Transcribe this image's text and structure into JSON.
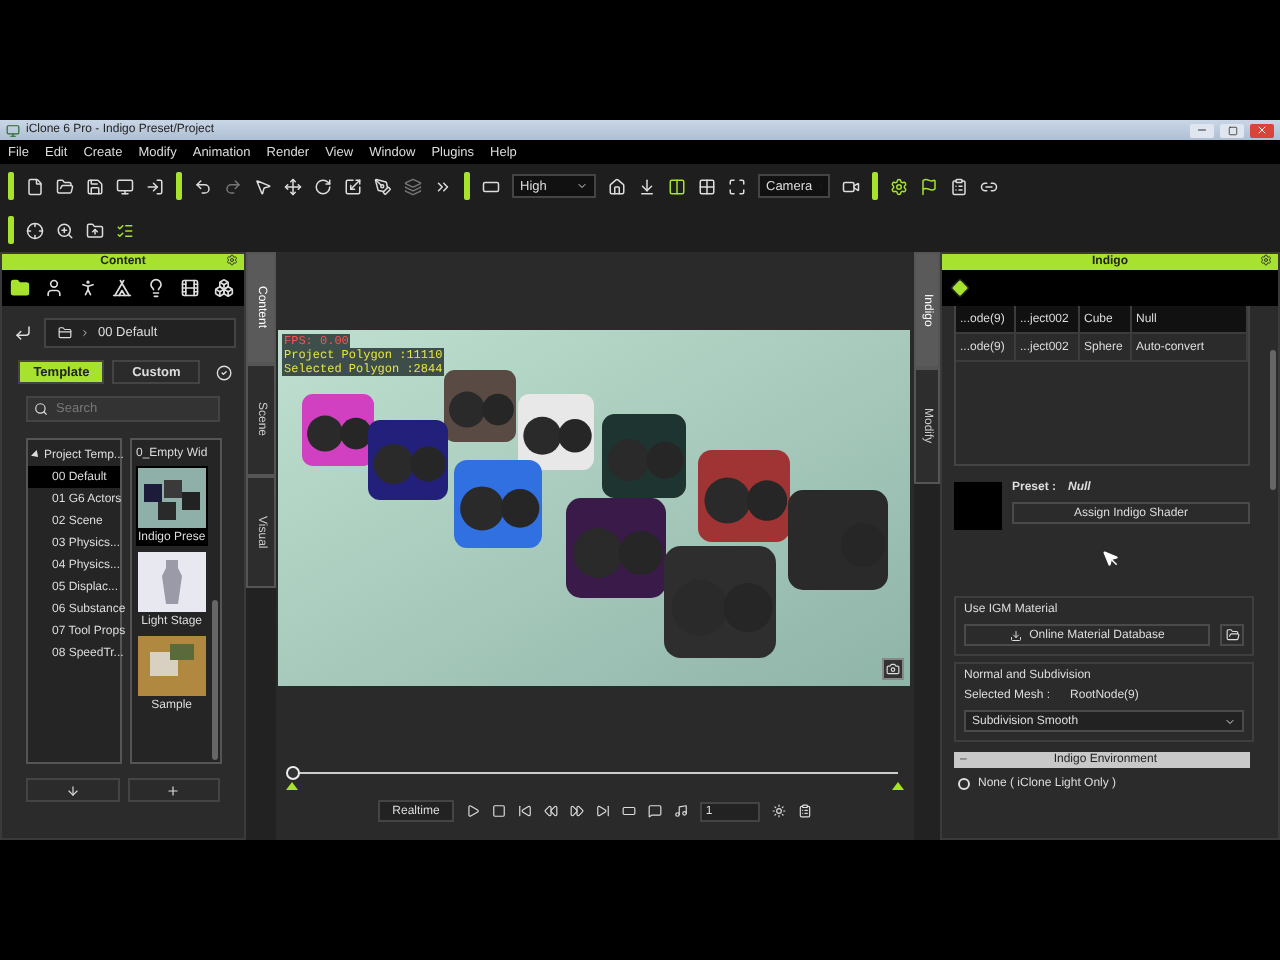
{
  "window": {
    "title": "iClone 6 Pro - Indigo Preset/Project"
  },
  "menu": [
    "File",
    "Edit",
    "Create",
    "Modify",
    "Animation",
    "Render",
    "View",
    "Window",
    "Plugins",
    "Help"
  ],
  "toolbar": {
    "quality": "High",
    "camera": "Camera"
  },
  "left_tabs": [
    {
      "label": "Content",
      "selected": true
    },
    {
      "label": "Scene",
      "selected": false
    },
    {
      "label": "Visual",
      "selected": false
    }
  ],
  "content_panel": {
    "title": "Content",
    "path": "00 Default",
    "tabs": [
      {
        "label": "Template",
        "selected": true
      },
      {
        "label": "Custom",
        "selected": false
      }
    ],
    "search": {
      "placeholder": "Search"
    },
    "tree": [
      {
        "label": "Project Temp...",
        "expanded": true,
        "selected": false,
        "children": [
          {
            "label": "00 Default",
            "selected": true
          },
          {
            "label": "01 G6 Actors",
            "selected": false
          },
          {
            "label": "02 Scene",
            "selected": false
          },
          {
            "label": "03 Physics...",
            "selected": false
          },
          {
            "label": "04 Physics...",
            "selected": false
          },
          {
            "label": "05 Displac...",
            "selected": false
          },
          {
            "label": "06 Substance",
            "selected": false
          },
          {
            "label": "07 Tool Props",
            "selected": false
          },
          {
            "label": "08 SpeedTr...",
            "selected": false
          }
        ]
      }
    ],
    "thumbnails": [
      {
        "label": "0_Empty Wid",
        "kind": "none",
        "selected": false
      },
      {
        "label": "Indigo Prese",
        "kind": "cubes",
        "selected": true
      },
      {
        "label": "Light Stage",
        "kind": "statue",
        "selected": false
      },
      {
        "label": "Sample",
        "kind": "room",
        "selected": false
      }
    ]
  },
  "viewport": {
    "overlay": [
      {
        "text": "FPS: 0.00",
        "kind": "fps"
      },
      {
        "text": "Project Polygon :11110",
        "kind": "stat"
      },
      {
        "text": "Selected Polygon :2844",
        "kind": "stat"
      }
    ]
  },
  "timeline": {
    "level": 0
  },
  "playback": {
    "mode": "Realtime",
    "frame": "1"
  },
  "right_tabs": [
    {
      "label": "Indigo",
      "selected": true
    },
    {
      "label": "Modify",
      "selected": false
    }
  ],
  "indigo_panel": {
    "title": "Indigo",
    "mesh_rows": [
      [
        "...ode(9)",
        "...ject002",
        "Cube",
        "Null"
      ],
      [
        "...ode(9)",
        "...ject002",
        "Sphere",
        "Auto-convert"
      ]
    ],
    "preset_label": "Preset :",
    "preset_value": "Null",
    "assign_button": "Assign Indigo Shader",
    "igm": {
      "title": "Use IGM Material",
      "button": "Online Material Database"
    },
    "subdivision": {
      "title": "Normal and Subdivision",
      "mesh_label": "Selected Mesh :",
      "mesh_value": "RootNode(9)",
      "mode": "Subdivision Smooth"
    },
    "environment": {
      "toggle": "–",
      "title": "Indigo Environment",
      "options": [
        {
          "label": "None ( iClone Light Only )",
          "selected": false
        }
      ]
    }
  }
}
